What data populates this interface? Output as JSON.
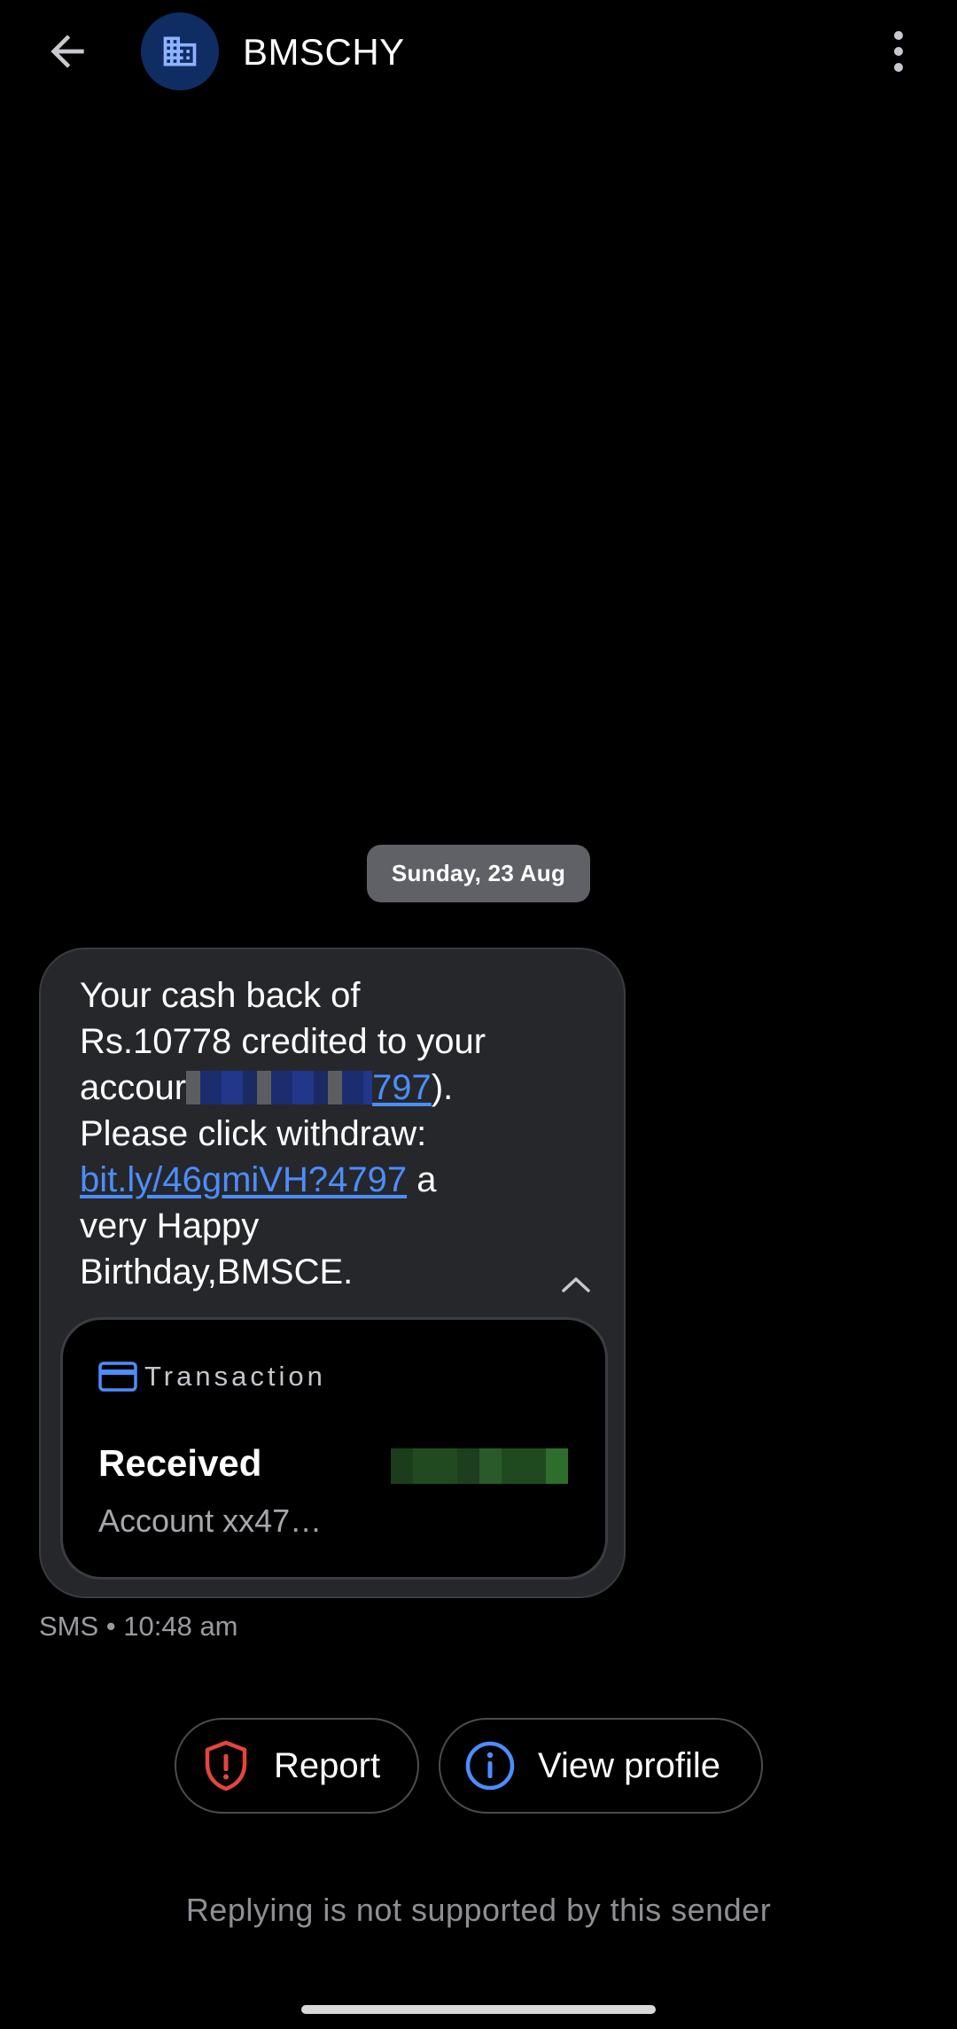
{
  "header": {
    "sender_name": "BMSCHY",
    "back_icon": "arrow-left-icon",
    "avatar_icon": "building-icon",
    "more_icon": "more-vertical-icon"
  },
  "date_chip": "Sunday, 23 Aug",
  "message": {
    "line1": "Your cash back of",
    "line2": "Rs.10778 credited to your",
    "line3_prefix": "accour",
    "line3_link_tail": "797",
    "line3_suffix": ").",
    "line4": "Please click withdraw:",
    "link": "bit.ly/46gmiVH?4797",
    "link_suffix": " a",
    "line6": "very Happy",
    "line7": "Birthday,BMSCE."
  },
  "transaction": {
    "header_label": "Transaction",
    "title": "Received",
    "subtitle": "Account xx47…"
  },
  "meta": "SMS • 10:48 am",
  "actions": {
    "report_label": "Report",
    "view_profile_label": "View profile"
  },
  "reply_note": "Replying is not supported by this sender",
  "colors": {
    "background": "#000000",
    "bubble": "#26272b",
    "date_chip": "#5f6166",
    "link": "#4c8dff",
    "avatar_bg": "#0f2d63",
    "avatar_icon": "#8fb2ff",
    "report_icon": "#e5453a",
    "info_icon": "#4c8dff",
    "transaction_label": "#c4c6cc"
  }
}
